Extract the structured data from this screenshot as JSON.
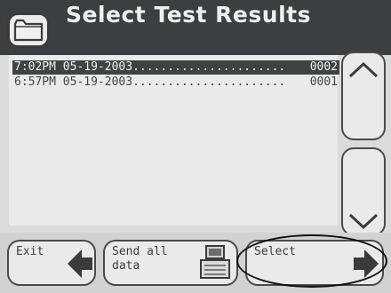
{
  "header": {
    "title": "Select Test Results",
    "folder_icon": "folder-icon"
  },
  "results": [
    {
      "time": "7:02PM 05-19-2003",
      "dots": "......................",
      "num": "0002",
      "selected": true
    },
    {
      "time": "6:57PM 05-19-2003",
      "dots": "......................",
      "num": "0001",
      "selected": false
    }
  ],
  "scroll": {
    "up_icon": "chevron-up-icon",
    "down_icon": "chevron-down-icon"
  },
  "buttons": {
    "exit": {
      "label": "Exit",
      "icon": "arrow-left-icon"
    },
    "send": {
      "label_line1": "Send all",
      "label_line2": "data",
      "icon": "printer-icon"
    },
    "select": {
      "label": "Select",
      "icon": "arrow-right-icon"
    }
  },
  "colors": {
    "header_bg": "#3c3f41",
    "selected_row_bg": "#3f4344",
    "panel_bg": "#e8ebe8"
  }
}
